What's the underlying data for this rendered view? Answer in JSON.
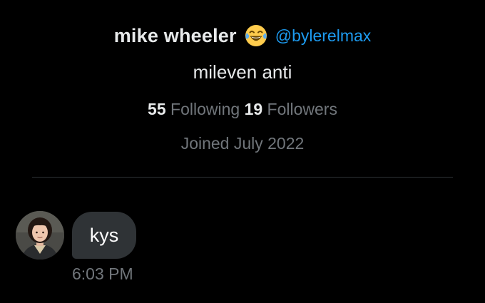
{
  "profile": {
    "display_name": "mike wheeler",
    "emoji": "face-with-tears-of-joy-emoji",
    "handle": "@bylerelmax",
    "bio": "mileven anti",
    "following_count": "55",
    "following_label": "Following",
    "followers_count": "19",
    "followers_label": "Followers",
    "joined": "Joined July 2022"
  },
  "message": {
    "text": "kys",
    "time": "6:03 PM"
  },
  "colors": {
    "background": "#000000",
    "text_primary": "#e7e9ea",
    "text_secondary": "#71767b",
    "link_blue": "#1d9bf0",
    "bubble": "#2f3336",
    "divider": "#2f3336"
  }
}
